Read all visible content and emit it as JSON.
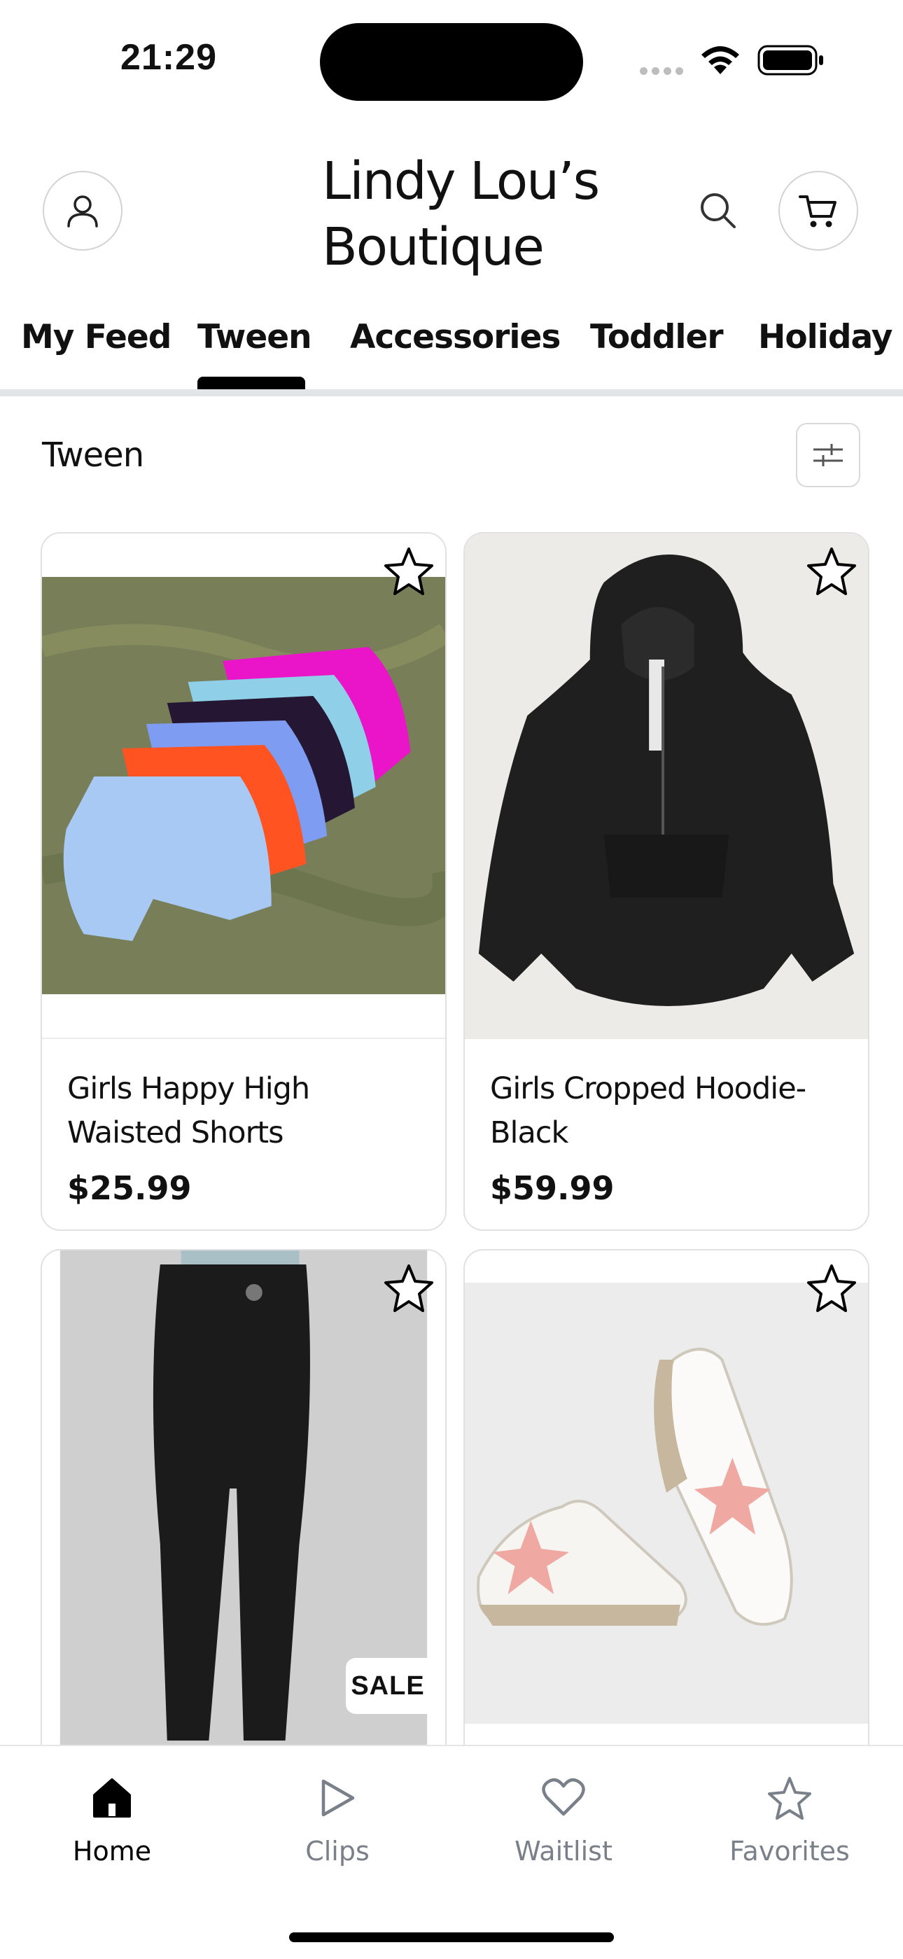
{
  "status_bar": {
    "time": "21:29"
  },
  "header": {
    "brand_line1": "Lindy Lou’s",
    "brand_line2": "Boutique"
  },
  "tabs": [
    {
      "label": "My Feed"
    },
    {
      "label": "Tween",
      "active": true
    },
    {
      "label": "Accessories"
    },
    {
      "label": "Toddler"
    },
    {
      "label": "Holiday It"
    }
  ],
  "section": {
    "title": "Tween"
  },
  "products": [
    {
      "title_line1": "Girls Happy High",
      "title_line2": "Waisted Shorts",
      "price": "$25.99",
      "image": "colorful-shorts-on-grass"
    },
    {
      "title_line1": "Girls Cropped Hoodie-",
      "title_line2": "Black",
      "price": "$59.99",
      "image": "black-cropped-hoodie"
    },
    {
      "badge": "SALE",
      "image": "black-leggings"
    },
    {
      "image": "white-star-sneakers"
    }
  ],
  "bottom_nav": [
    {
      "label": "Home",
      "icon": "home-icon",
      "active": true
    },
    {
      "label": "Clips",
      "icon": "play-icon"
    },
    {
      "label": "Waitlist",
      "icon": "heart-icon"
    },
    {
      "label": "Favorites",
      "icon": "star-icon"
    }
  ],
  "colors": {
    "accent": "#000000",
    "inactive_nav": "#7a8089",
    "divider": "#e2e5e8"
  }
}
